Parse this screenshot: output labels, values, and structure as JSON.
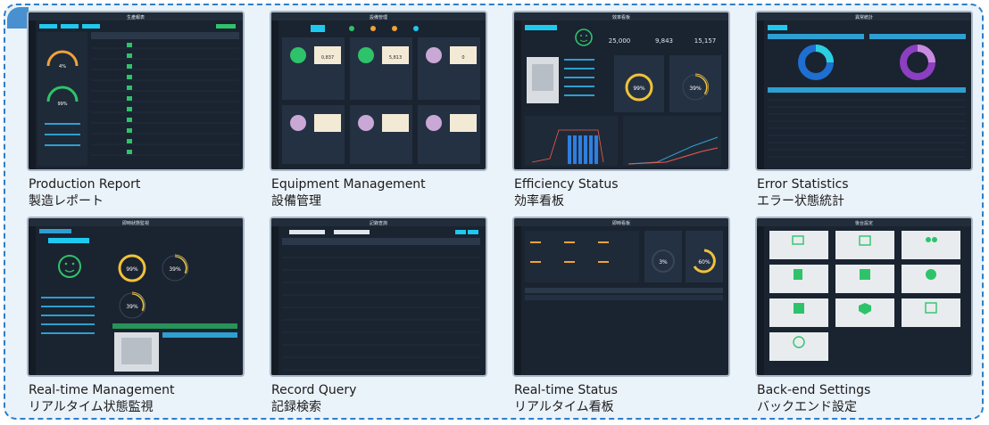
{
  "colors": {
    "frame": "#2c7fc8",
    "panel_bg": "#1a2330",
    "accent": "#1ec9f0",
    "green": "#2ec36a",
    "orange": "#f0a23a",
    "purple": "#9b59c6",
    "caption": "#1b1b1b"
  },
  "cards": [
    {
      "en": "Production Report",
      "jp": "製造レポート",
      "screen_title": "生產報表"
    },
    {
      "en": "Equipment Management",
      "jp": "設備管理",
      "screen_title": "設備管理"
    },
    {
      "en": "Efficiency Status",
      "jp": "効率看板",
      "screen_title": "效率看板",
      "numbers": [
        "25,000",
        "9,843",
        "15,157"
      ],
      "gauges": [
        "99%",
        "39%"
      ]
    },
    {
      "en": "Error Statistics",
      "jp": "エラー状態統計",
      "screen_title": "異常統計"
    },
    {
      "en": "Real-time Management",
      "jp": "リアルタイム状態監視",
      "screen_title": "即時狀態監視",
      "gauges": [
        "99%",
        "39%",
        "39%"
      ]
    },
    {
      "en": "Record Query",
      "jp": "記録検索",
      "screen_title": "記錄查詢"
    },
    {
      "en": "Real-time Status",
      "jp": "リアルタイム看板",
      "screen_title": "即時看板",
      "gauges": [
        "3%",
        "60%"
      ]
    },
    {
      "en": "Back-end Settings",
      "jp": "バックエンド設定",
      "screen_title": "後台設定"
    }
  ],
  "production": {
    "gauges": [
      "4%",
      "99%"
    ]
  },
  "equipment": {
    "values": [
      "0,837",
      "5,813",
      "0"
    ]
  }
}
